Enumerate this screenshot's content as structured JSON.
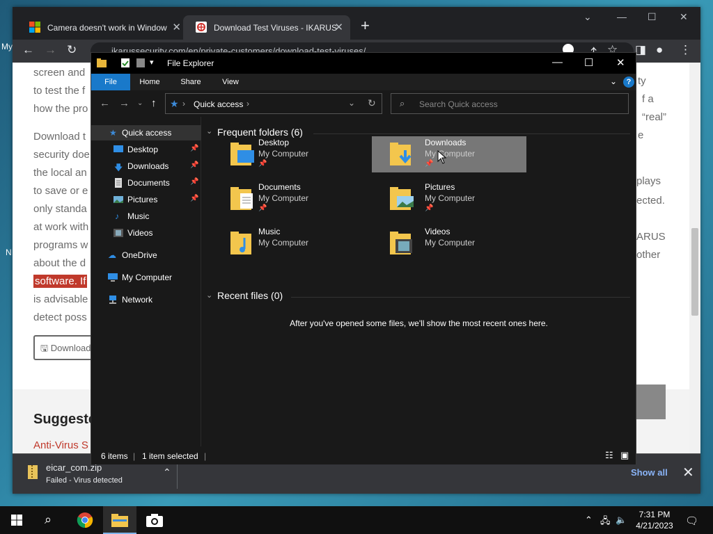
{
  "desktop": {
    "icon_label_1": "My",
    "icon_label_2": "N"
  },
  "browser": {
    "tabs": [
      {
        "label": "Camera doesn't work in Window"
      },
      {
        "label": "Download Test Viruses - IKARUS"
      }
    ],
    "url": "ikarussecurity.com/en/private-customers/download-test-viruses/",
    "page": {
      "lines": [
        "screen and",
        "to test the f",
        "how the pro"
      ],
      "para_lines": [
        "Download t",
        "security doe",
        "the local an",
        "to save or e",
        "only standa",
        "at work with",
        "programs w",
        "about the d"
      ],
      "highlight": "software. If",
      "after_lines": [
        "is advisable",
        "detect poss"
      ],
      "right_lines": [
        "ty",
        "f a",
        "“real”",
        "e",
        "plays",
        "ected.",
        "ARUS",
        "other"
      ],
      "download_button": "Download",
      "suggested_heading": "Suggeste",
      "antivirus_link": "Anti-Virus S"
    },
    "download_bar": {
      "file_name": "eicar_com.zip",
      "status": "Failed - Virus detected",
      "show_all": "Show all"
    }
  },
  "explorer": {
    "title": "File Explorer",
    "ribbon_tabs": [
      "File",
      "Home",
      "Share",
      "View"
    ],
    "address": "Quick access",
    "search_placeholder": "Search Quick access",
    "nav": [
      {
        "label": "Quick access",
        "icon": "star-icon"
      },
      {
        "label": "Desktop",
        "icon": "desktop-icon",
        "pinned": true
      },
      {
        "label": "Downloads",
        "icon": "download-icon",
        "pinned": true
      },
      {
        "label": "Documents",
        "icon": "documents-icon",
        "pinned": true
      },
      {
        "label": "Pictures",
        "icon": "pictures-icon",
        "pinned": true
      },
      {
        "label": "Music",
        "icon": "music-icon"
      },
      {
        "label": "Videos",
        "icon": "videos-icon"
      },
      {
        "label": "OneDrive",
        "icon": "cloud-icon"
      },
      {
        "label": "My Computer",
        "icon": "computer-icon"
      },
      {
        "label": "Network",
        "icon": "network-icon"
      }
    ],
    "frequent_header": "Frequent folders (6)",
    "folders": [
      {
        "name": "Desktop",
        "location": "My Computer",
        "pinned": true,
        "selected": false
      },
      {
        "name": "Downloads",
        "location": "My Computer",
        "pinned": true,
        "selected": true
      },
      {
        "name": "Documents",
        "location": "My Computer",
        "pinned": true,
        "selected": false
      },
      {
        "name": "Pictures",
        "location": "My Computer",
        "pinned": true,
        "selected": false
      },
      {
        "name": "Music",
        "location": "My Computer",
        "pinned": false,
        "selected": false
      },
      {
        "name": "Videos",
        "location": "My Computer",
        "pinned": false,
        "selected": false
      }
    ],
    "recent_header": "Recent files (0)",
    "recent_empty": "After you've opened some files, we'll show the most recent ones here.",
    "status": {
      "items": "6 items",
      "selected": "1 item selected"
    }
  },
  "taskbar": {
    "time": "7:31 PM",
    "date": "4/21/2023"
  },
  "colors": {
    "accent": "#1979ca",
    "link_red": "#c0392b",
    "chrome_dark": "#202124"
  }
}
